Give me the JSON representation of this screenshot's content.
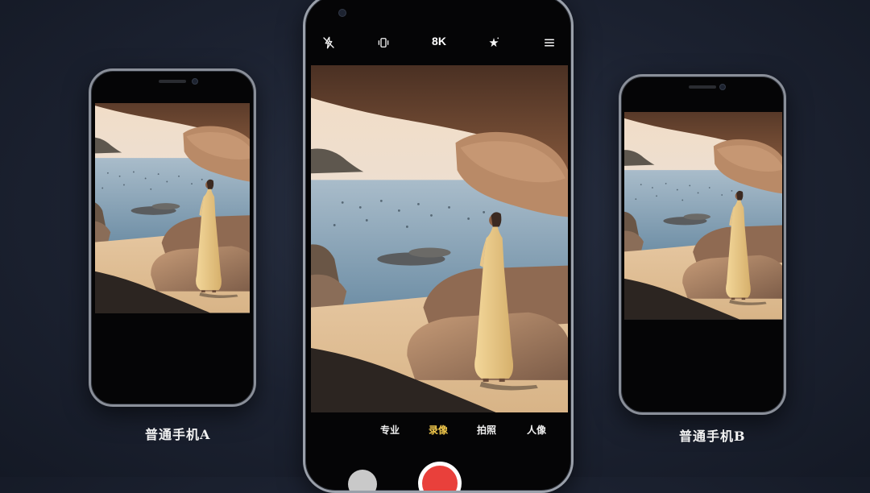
{
  "phones": {
    "left": {
      "caption": "普通手机A"
    },
    "right": {
      "caption": "普通手机B"
    },
    "center": {
      "toolbar": {
        "flash_icon": "flash-off-icon",
        "stabilize_icon": "vibration-stabilize-icon",
        "resolution": "8K",
        "effects_icon": "magic-sparkle-icon",
        "menu_icon": "hamburger-menu-icon"
      },
      "modes": [
        {
          "label": "专业",
          "active": false
        },
        {
          "label": "录像",
          "active": true
        },
        {
          "label": "拍照",
          "active": false
        },
        {
          "label": "人像",
          "active": false
        }
      ]
    }
  },
  "colors": {
    "background": "#1c2231",
    "active_mode": "#f2c94c",
    "shutter_record": "#e9403b"
  }
}
